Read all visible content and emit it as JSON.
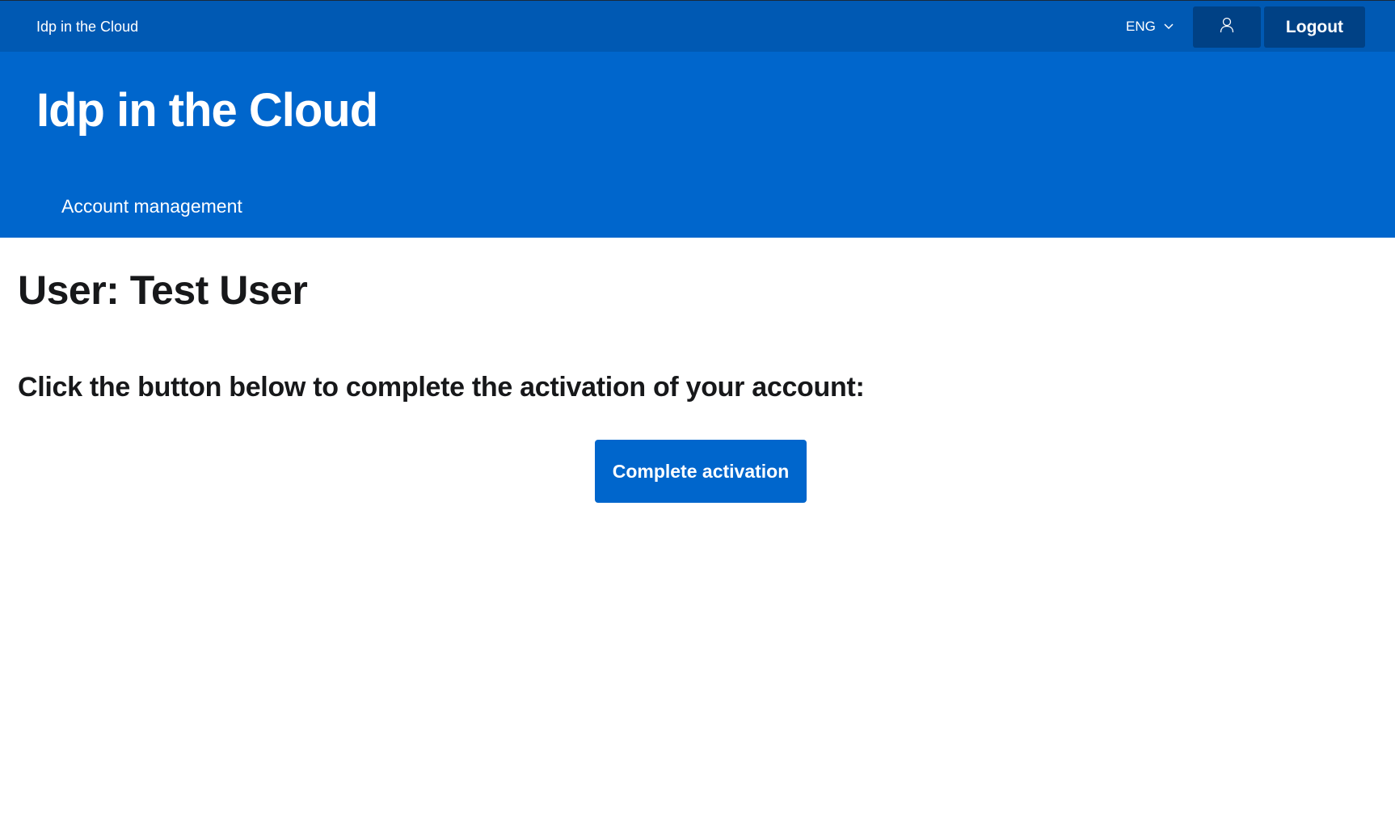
{
  "topbar": {
    "brand": "Idp in the Cloud",
    "language": "ENG",
    "user_icon": "user-icon",
    "language_chevron_icon": "chevron-down-icon",
    "logout_label": "Logout"
  },
  "header": {
    "title": "Idp in the Cloud",
    "nav": [
      {
        "label": "Account management"
      }
    ]
  },
  "main": {
    "page_title": "User: Test User",
    "instruction": "Click the button below to complete the activation of your account:",
    "activate_label": "Complete activation"
  },
  "colors": {
    "topbar_bg": "#0059b3",
    "header_bg": "#0066cc",
    "dark_button_bg": "#004185",
    "primary_button_bg": "#0066cc",
    "text_dark": "#17181a"
  }
}
